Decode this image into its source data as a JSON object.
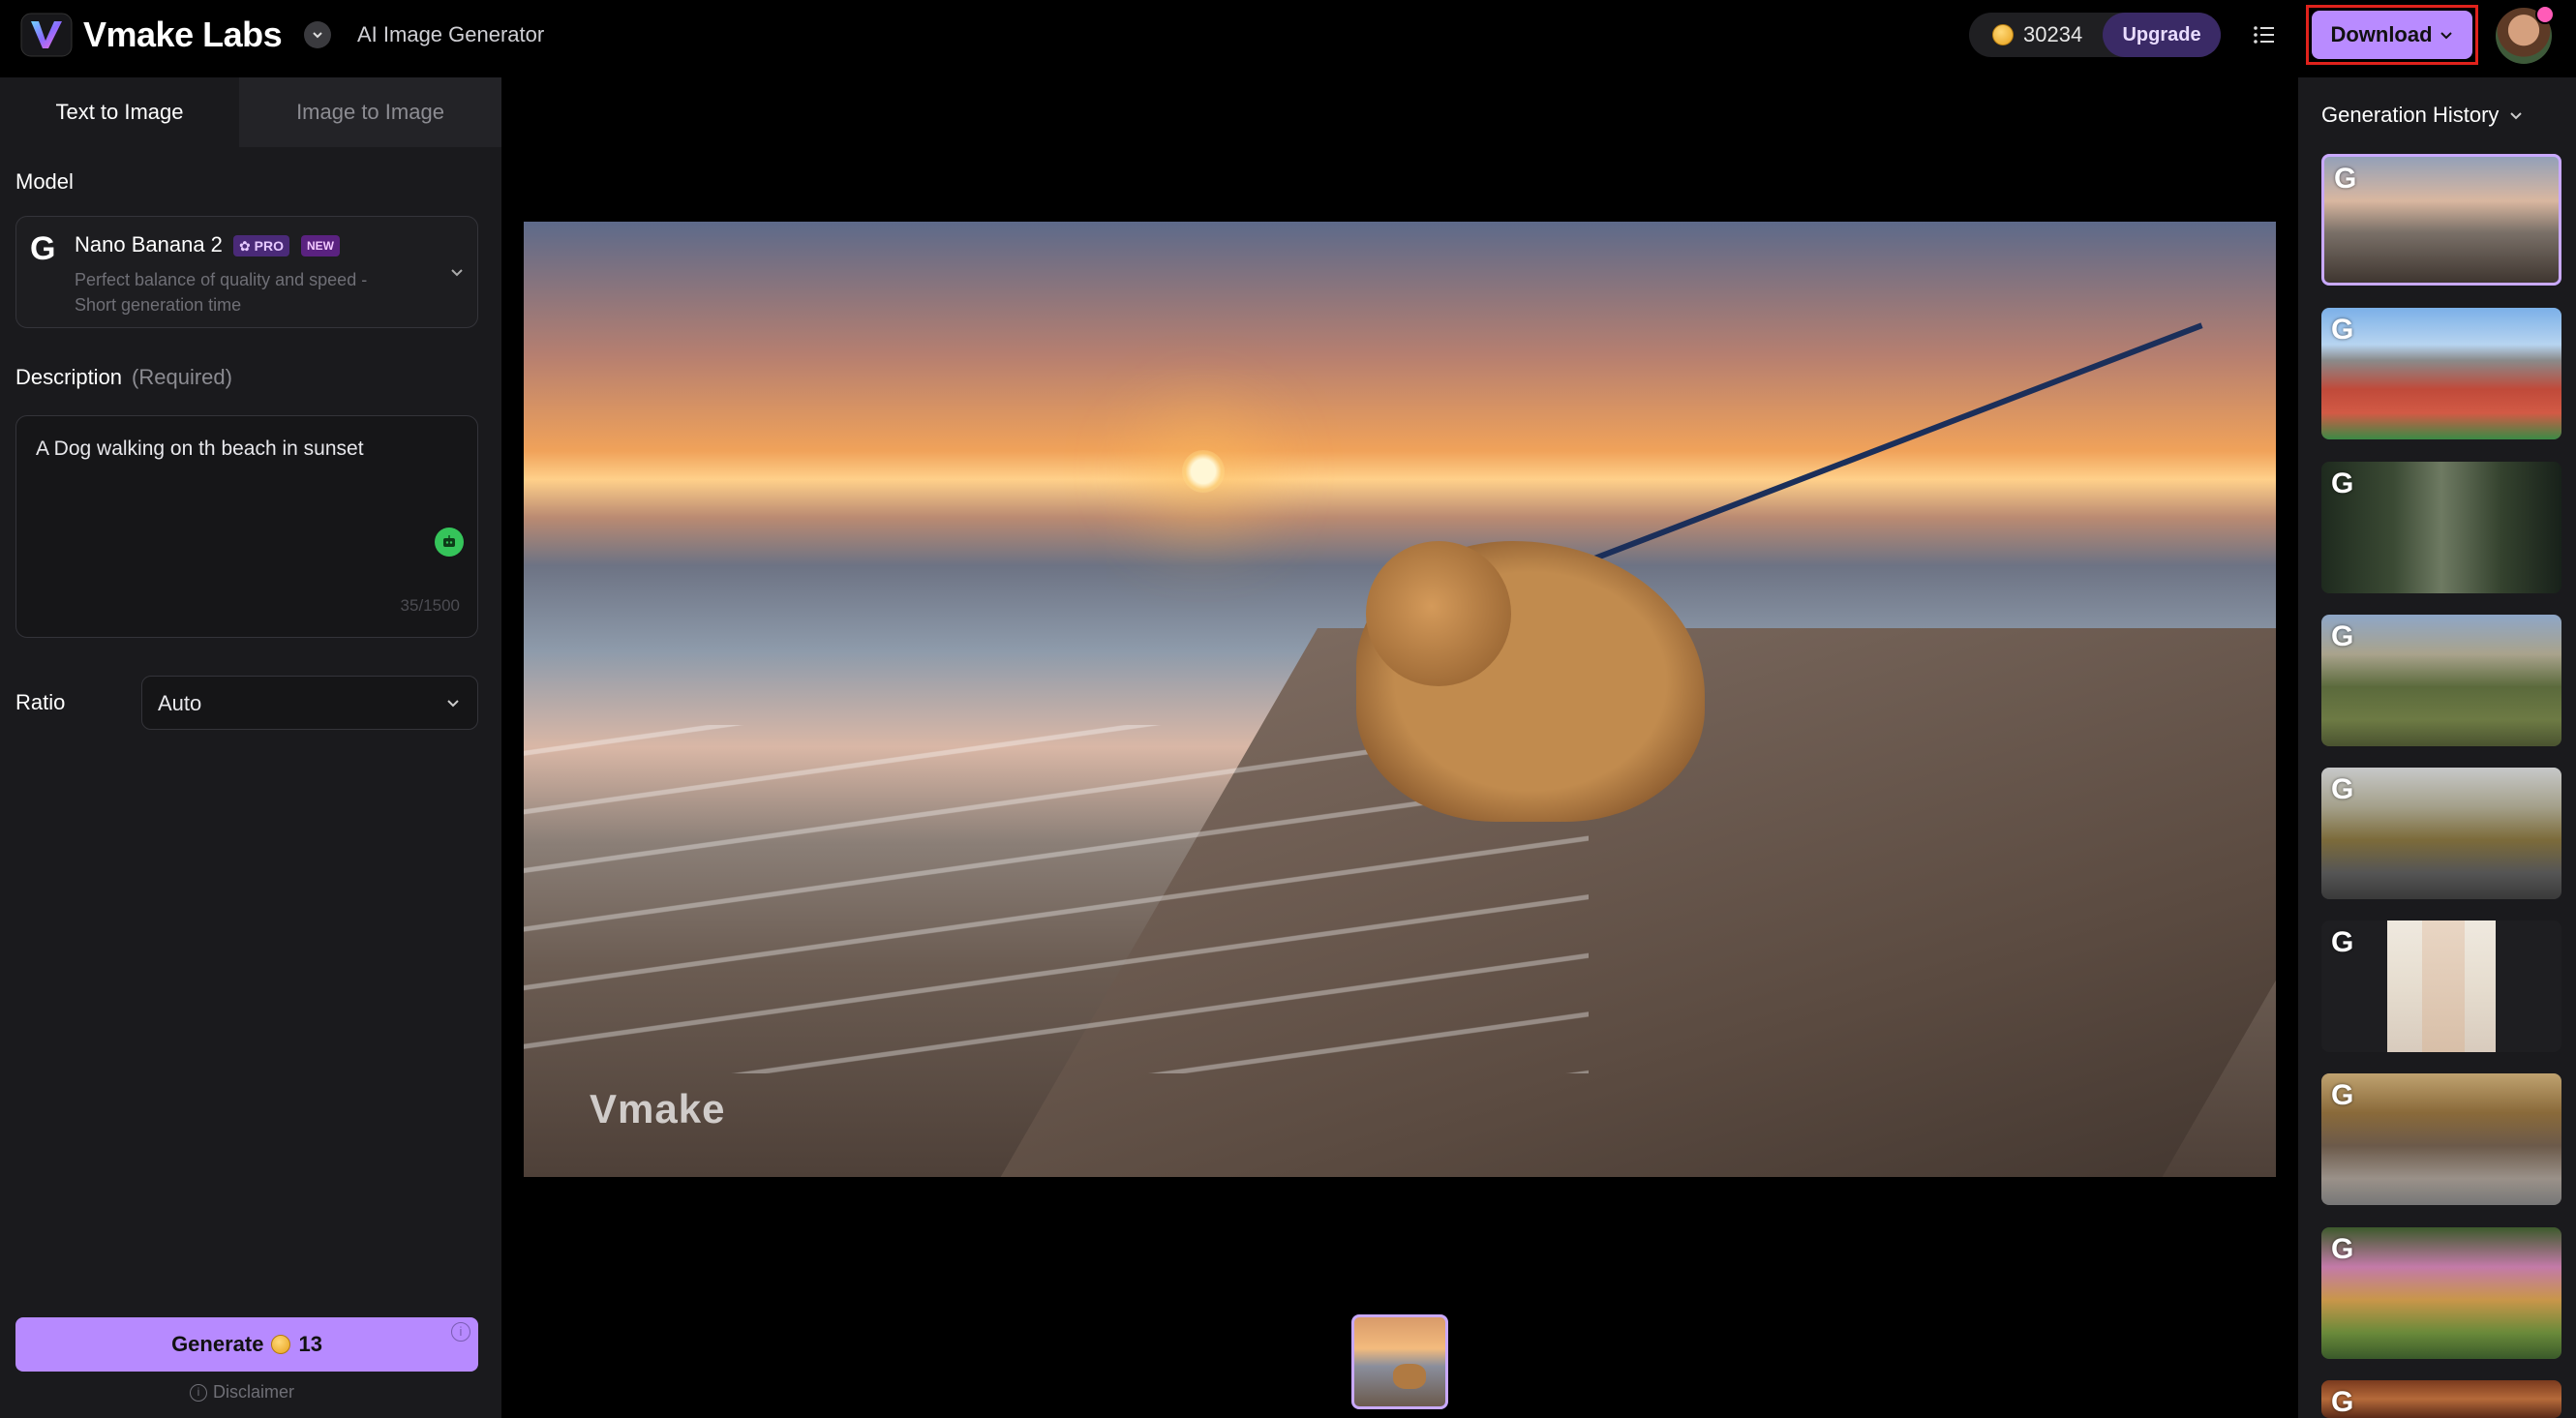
{
  "header": {
    "brand": "Vmake Labs",
    "app_name": "AI Image Generator",
    "credits": "30234",
    "upgrade_label": "Upgrade",
    "download_label": "Download"
  },
  "tabs": {
    "text_to_image": "Text to Image",
    "image_to_image": "Image to Image",
    "active": "Text to Image"
  },
  "model": {
    "section_label": "Model",
    "name": "Nano Banana 2",
    "pro_badge": "✿ PRO",
    "new_badge": "NEW",
    "description": "Perfect balance of quality and speed - Short generation time"
  },
  "description": {
    "section_label": "Description",
    "required_label": "(Required)",
    "value": "A Dog walking on th beach in sunset",
    "char_count": "35/1500"
  },
  "ratio": {
    "section_label": "Ratio",
    "value": "Auto"
  },
  "generate": {
    "label": "Generate",
    "cost": "13"
  },
  "disclaimer": "Disclaimer",
  "preview": {
    "watermark": "Vmake"
  },
  "history": {
    "title": "Generation History",
    "items": [
      {
        "icon": "g-model-icon",
        "selected": true
      },
      {
        "icon": "g-model-icon"
      },
      {
        "icon": "g-model-icon"
      },
      {
        "icon": "g-model-icon"
      },
      {
        "icon": "g-model-icon"
      },
      {
        "icon": "g-model-icon"
      },
      {
        "icon": "g-model-icon"
      },
      {
        "icon": "g-model-icon"
      },
      {
        "icon": "g-model-icon"
      }
    ]
  },
  "colors": {
    "accent": "#b78aff",
    "download_highlight": "#e0221c",
    "panel_bg": "#1a1a1d",
    "enhance_green": "#35c45a"
  }
}
